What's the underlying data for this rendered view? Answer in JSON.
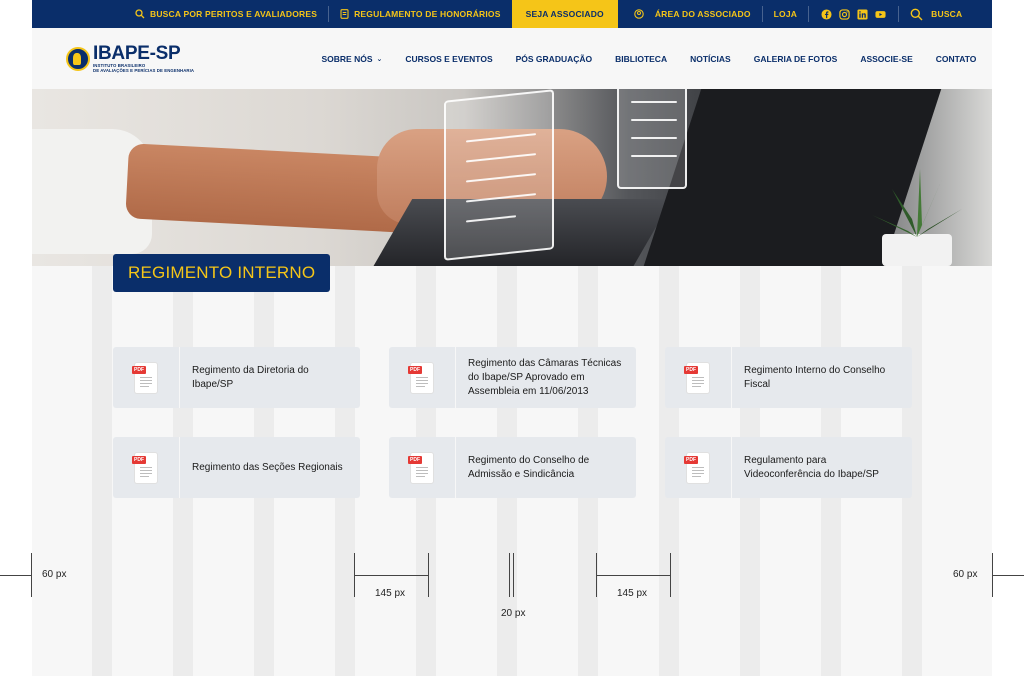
{
  "topbar": {
    "items": [
      {
        "label": "BUSCA POR PERITOS E AVALIADORES",
        "icon": "search-icon"
      },
      {
        "label": "REGULAMENTO DE HONORÁRIOS",
        "icon": "document-icon"
      },
      {
        "label": "SEJA ASSOCIADO",
        "icon": ""
      },
      {
        "label": "ÁREA DO ASSOCIADO",
        "icon": "user-circle-icon"
      },
      {
        "label": "LOJA",
        "icon": ""
      }
    ],
    "socials": [
      "facebook-icon",
      "instagram-icon",
      "linkedin-icon",
      "youtube-icon"
    ],
    "search_label": "BUSCA",
    "colors": {
      "bg": "#0a2e6a",
      "accent": "#f5c518"
    }
  },
  "logo": {
    "name": "IBAPE-SP",
    "sub_line1": "INSTITUTO BRASILEIRO",
    "sub_line2": "DE AVALIAÇÕES E PERÍCIAS DE ENGENHARIA"
  },
  "nav": {
    "items": [
      "SOBRE NÓS",
      "CURSOS E EVENTOS",
      "PÓS GRADUAÇÃO",
      "BIBLIOTECA",
      "NOTÍCIAS",
      "GALERIA DE FOTOS",
      "ASSOCIE-SE",
      "CONTATO"
    ],
    "dropdown_chevron": "⌄"
  },
  "page_title": "REGIMENTO INTERNO",
  "documents": [
    {
      "title": "Regimento da Diretoria do Ibape/SP",
      "badge": "PDF"
    },
    {
      "title": "Regimento das Câmaras Técnicas do Ibape/SP Aprovado em Assembleia em 11/06/2013",
      "badge": "PDF"
    },
    {
      "title": "Regimento Interno do Conselho Fiscal",
      "badge": "PDF"
    },
    {
      "title": "Regimento das Seções Regionais",
      "badge": "PDF"
    },
    {
      "title": "Regimento do Conselho de Admissão e Sindicância",
      "badge": "PDF"
    },
    {
      "title": "Regulamento para Videoconferência do Ibape/SP",
      "badge": "PDF"
    }
  ],
  "annotations": {
    "margin_left": "60 px",
    "margin_right": "60 px",
    "column": "145 px",
    "gutter": "20 px",
    "column_right": "145 px"
  }
}
